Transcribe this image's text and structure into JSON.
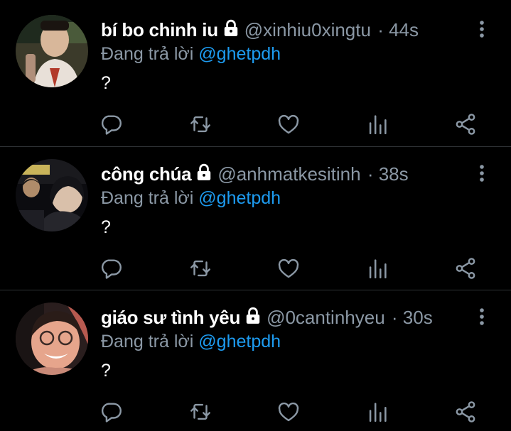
{
  "tweets": [
    {
      "display_name": "bí bo chinh iu",
      "handle": "@xinhiu0xingtu",
      "time": "· 44s",
      "replying_prefix": "Đang trả lời",
      "replying_to": "@ghetpdh",
      "text": "?",
      "icons": {
        "protected": "lock-icon",
        "more": "more-vertical-icon"
      },
      "avatar": "avatar-photo"
    },
    {
      "display_name": "công chúa",
      "handle": "@anhmatkesitinh",
      "time": "· 38s",
      "replying_prefix": "Đang trả lời",
      "replying_to": "@ghetpdh",
      "text": "?",
      "icons": {
        "protected": "lock-icon",
        "more": "more-vertical-icon"
      },
      "avatar": "avatar-photo"
    },
    {
      "display_name": "giáo sư tình yêu",
      "handle": "@0cantinhyeu",
      "time": "· 30s",
      "replying_prefix": "Đang trả lời",
      "replying_to": "@ghetpdh",
      "text": "?",
      "icons": {
        "protected": "lock-icon",
        "more": "more-vertical-icon"
      },
      "avatar": "avatar-photo"
    }
  ],
  "action_icons": [
    "reply-icon",
    "retweet-icon",
    "like-icon",
    "analytics-icon",
    "share-icon"
  ],
  "colors": {
    "background": "#000000",
    "text_primary": "#ffffff",
    "text_secondary": "#8b98a5",
    "mention": "#1d9bf0",
    "divider": "#2f3336"
  }
}
